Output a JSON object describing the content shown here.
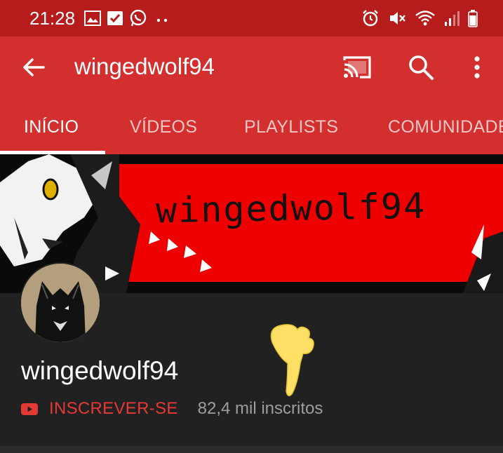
{
  "status_bar": {
    "time": "21:28",
    "left_icons": [
      "image-icon",
      "check-box-icon",
      "whatsapp-icon",
      "more-notifications-icon"
    ],
    "right_icons": [
      "alarm-icon",
      "mute-icon",
      "wifi-icon",
      "signal-icon",
      "battery-icon"
    ]
  },
  "app_bar": {
    "title": "wingedwolf94",
    "actions": [
      "cast-icon",
      "search-icon",
      "more-vert-icon"
    ]
  },
  "tabs": [
    {
      "label": "INÍCIO",
      "active": true
    },
    {
      "label": "VÍDEOS",
      "active": false
    },
    {
      "label": "PLAYLISTS",
      "active": false
    },
    {
      "label": "COMUNIDADE",
      "active": false
    }
  ],
  "banner": {
    "text": "wingedwolf94"
  },
  "channel": {
    "name": "wingedwolf94",
    "subscribe_label": "INSCREVER-SE",
    "subscriber_count": "82,4 mil inscritos"
  },
  "colors": {
    "status_bar": "#b71c1c",
    "app_bar": "#d32f2f",
    "background": "#212121",
    "subscribe": "#e53935",
    "banner_red": "#ee0000"
  }
}
